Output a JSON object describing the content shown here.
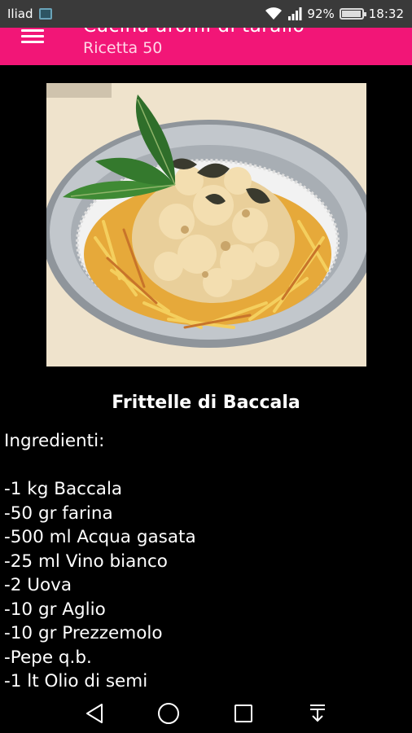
{
  "status_bar": {
    "carrier": "Iliad",
    "battery": "92%",
    "time": "18:32"
  },
  "app_bar": {
    "title": "Cucina aromi di tarallo",
    "subtitle": "Ricetta 50"
  },
  "recipe": {
    "image_icon": "fried-cod-fritters-photo",
    "title": "Frittelle di Baccala",
    "lines": [
      "Ingredienti:",
      "",
      "-1 kg Baccala",
      "-50 gr farina",
      "-500 ml Acqua gasata",
      "-25 ml Vino bianco",
      "-2 Uova",
      "-10 gr Aglio",
      "-10 gr Prezzemolo",
      "-Pepe q.b.",
      "-1 lt Olio di semi"
    ]
  },
  "colors": {
    "accent": "#f21677",
    "background": "#000000"
  }
}
